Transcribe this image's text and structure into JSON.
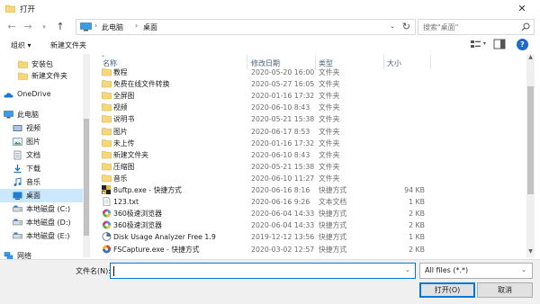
{
  "window": {
    "title": "打开"
  },
  "nav": {
    "address": {
      "segments": [
        "此电脑",
        "桌面"
      ]
    },
    "search_placeholder": "搜索\"桌面\""
  },
  "toolbar": {
    "organize": "组织 ▾",
    "new_folder": "新建文件夹"
  },
  "sidebar": {
    "items": [
      {
        "label": "安装包",
        "icon": "folder-icon"
      },
      {
        "label": "新建文件夹",
        "icon": "folder-icon"
      },
      {
        "label": "OneDrive",
        "icon": "onedrive-icon"
      },
      {
        "label": "此电脑",
        "icon": "computer-icon"
      },
      {
        "label": "视频",
        "icon": "video-icon"
      },
      {
        "label": "图片",
        "icon": "pictures-icon"
      },
      {
        "label": "文档",
        "icon": "documents-icon"
      },
      {
        "label": "下载",
        "icon": "download-icon"
      },
      {
        "label": "音乐",
        "icon": "music-icon"
      },
      {
        "label": "桌面",
        "icon": "desktop-icon",
        "selected": true
      },
      {
        "label": "本地磁盘 (C:)",
        "icon": "drive-icon"
      },
      {
        "label": "本地磁盘 (D:)",
        "icon": "drive-icon"
      },
      {
        "label": "本地磁盘 (E:)",
        "icon": "drive-icon"
      },
      {
        "label": "网络",
        "icon": "network-icon"
      }
    ]
  },
  "columns": {
    "name": "名称",
    "modified": "修改日期",
    "type": "类型",
    "size": "大小"
  },
  "files": [
    {
      "name": "教程",
      "modified": "2020-05-20 16:00",
      "type": "文件夹",
      "size": "",
      "icon": "folder-icon"
    },
    {
      "name": "免费在线文件转换",
      "modified": "2020-05-27 16:05",
      "type": "文件夹",
      "size": "",
      "icon": "folder-icon"
    },
    {
      "name": "全屏图",
      "modified": "2020-01-16 17:32",
      "type": "文件夹",
      "size": "",
      "icon": "folder-icon"
    },
    {
      "name": "视频",
      "modified": "2020-06-10 8:43",
      "type": "文件夹",
      "size": "",
      "icon": "folder-icon"
    },
    {
      "name": "说明书",
      "modified": "2020-05-21 15:38",
      "type": "文件夹",
      "size": "",
      "icon": "folder-icon"
    },
    {
      "name": "图片",
      "modified": "2020-06-17 8:53",
      "type": "文件夹",
      "size": "",
      "icon": "folder-icon"
    },
    {
      "name": "未上传",
      "modified": "2020-01-16 17:32",
      "type": "文件夹",
      "size": "",
      "icon": "folder-icon"
    },
    {
      "name": "新建文件夹",
      "modified": "2020-06-10 8:43",
      "type": "文件夹",
      "size": "",
      "icon": "folder-icon"
    },
    {
      "name": "压缩图",
      "modified": "2020-05-21 15:38",
      "type": "文件夹",
      "size": "",
      "icon": "folder-icon"
    },
    {
      "name": "音乐",
      "modified": "2020-06-10 11:27",
      "type": "文件夹",
      "size": "",
      "icon": "folder-icon"
    },
    {
      "name": "8uftp.exe - 快捷方式",
      "modified": "2020-06-16 8:16",
      "type": "快捷方式",
      "size": "94 KB",
      "icon": "ftp-shortcut-icon"
    },
    {
      "name": "123.txt",
      "modified": "2020-06-16 9:26",
      "type": "文本文档",
      "size": "1 KB",
      "icon": "text-file-icon"
    },
    {
      "name": "360极速浏览器",
      "modified": "2020-06-04 14:33",
      "type": "快捷方式",
      "size": "2 KB",
      "icon": "browser-360-icon"
    },
    {
      "name": "360极速浏览器",
      "modified": "2020-06-04 14:33",
      "type": "快捷方式",
      "size": "2 KB",
      "icon": "browser-360-icon"
    },
    {
      "name": "Disk Usage Analyzer Free 1.9",
      "modified": "2019-12-12 13:56",
      "type": "快捷方式",
      "size": "1 KB",
      "icon": "disk-analyzer-icon"
    },
    {
      "name": "FSCapture.exe - 快捷方式",
      "modified": "2020-03-02 12:57",
      "type": "快捷方式",
      "size": "2 KB",
      "icon": "fscapture-icon"
    }
  ],
  "bottom": {
    "filename_label": "文件名(N):",
    "filename_value": "",
    "filetype": "All files (*.*)",
    "open_button": "打开(O)",
    "cancel_button": "取消"
  },
  "colors": {
    "selection": "#cce8ff",
    "accent": "#0078d7",
    "folder": "#f8d775"
  }
}
